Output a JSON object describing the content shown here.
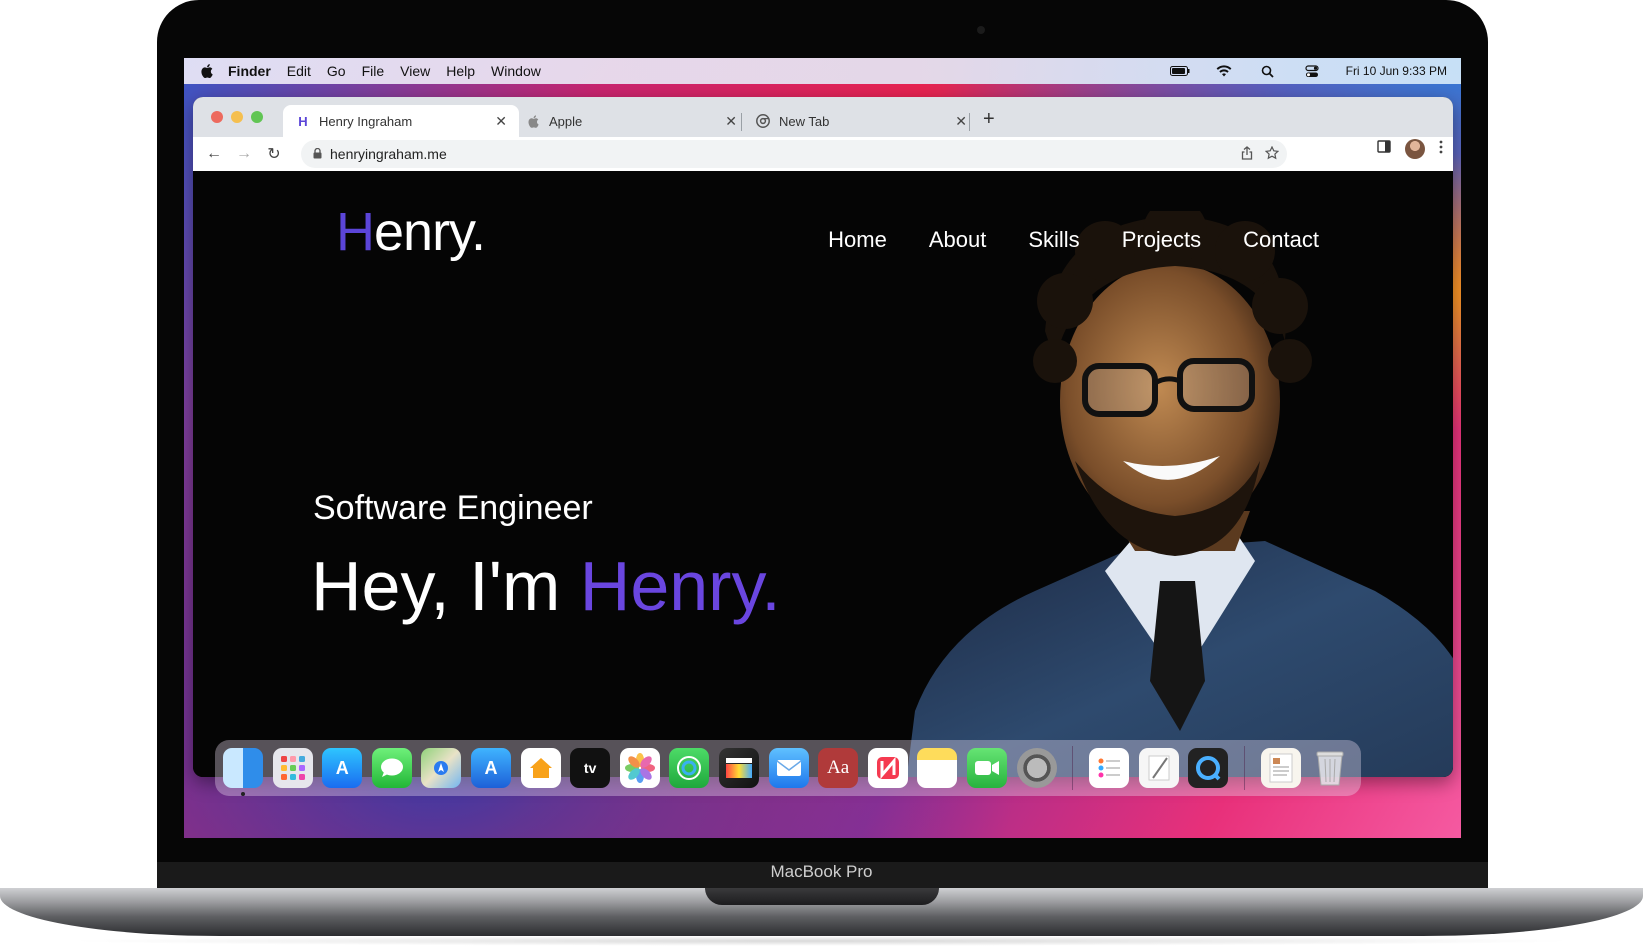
{
  "device": {
    "label": "MacBook Pro"
  },
  "menubar": {
    "app_name": "Finder",
    "items": [
      "Edit",
      "Go",
      "File",
      "View",
      "Help",
      "Window"
    ],
    "datetime": "Fri 10 Jun  9:33 PM",
    "status_icons": [
      "battery-icon",
      "wifi-icon",
      "spotlight-search-icon",
      "control-center-icon"
    ]
  },
  "browser": {
    "tabs": [
      {
        "title": "Henry Ingraham",
        "favicon": "H",
        "active": true
      },
      {
        "title": "Apple",
        "favicon": "apple-icon",
        "active": false
      },
      {
        "title": "New Tab",
        "favicon": "chrome-icon",
        "active": false
      }
    ],
    "url": "henryingraham.me"
  },
  "site": {
    "logo_initial": "H",
    "logo_rest": "enry.",
    "nav": [
      "Home",
      "About",
      "Skills",
      "Projects",
      "Contact"
    ],
    "subtitle": "Software Engineer",
    "hero_prefix": "Hey, I'm ",
    "hero_name": "Henry.",
    "accent_color": "#5b45d8"
  },
  "dock": {
    "apps": [
      "Finder",
      "Launchpad",
      "App Store",
      "Messages",
      "Maps",
      "Xcode",
      "Home",
      "TV",
      "Photos",
      "Find My",
      "Final Cut Pro",
      "Mail",
      "Dictionary",
      "News",
      "Notes",
      "FaceTime",
      "System Preferences"
    ],
    "recent": [
      "Reminders",
      "TextEdit",
      "QuickTime Player"
    ],
    "other": [
      "Document",
      "Trash"
    ]
  }
}
